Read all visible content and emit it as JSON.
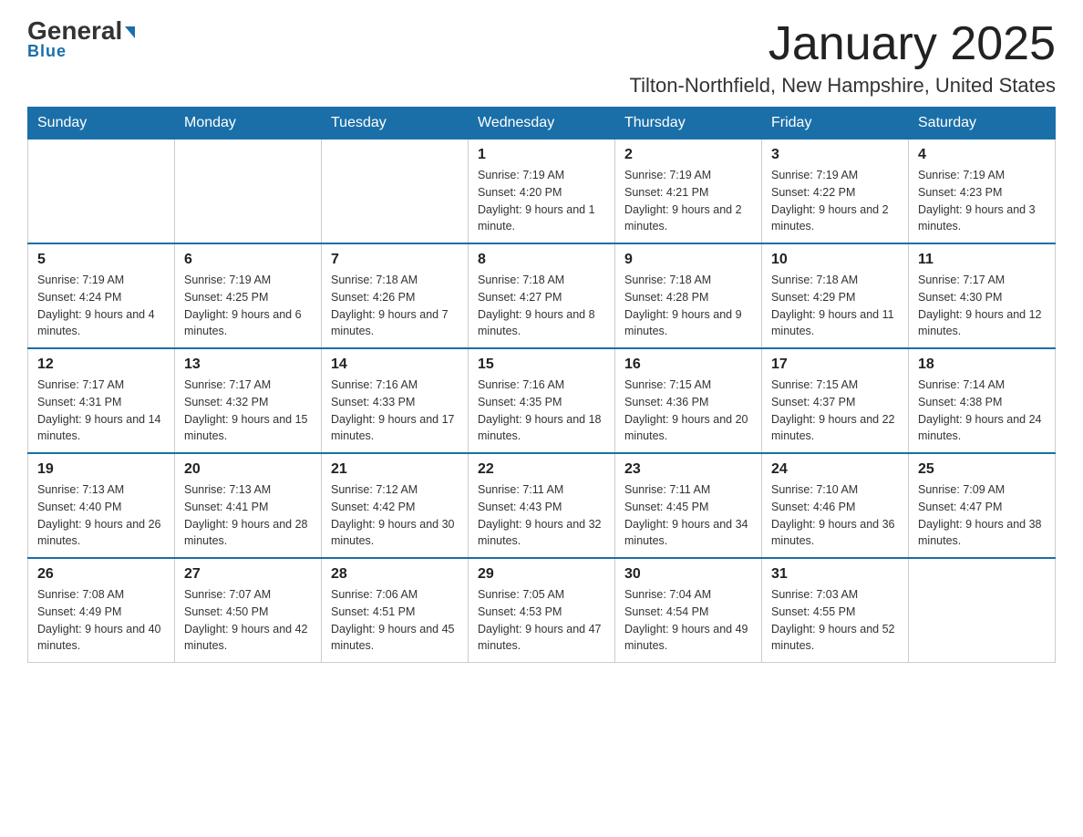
{
  "header": {
    "logo_general": "General",
    "logo_blue": "Blue",
    "month_title": "January 2025",
    "location": "Tilton-Northfield, New Hampshire, United States"
  },
  "weekdays": [
    "Sunday",
    "Monday",
    "Tuesday",
    "Wednesday",
    "Thursday",
    "Friday",
    "Saturday"
  ],
  "weeks": [
    [
      {
        "day": "",
        "info": ""
      },
      {
        "day": "",
        "info": ""
      },
      {
        "day": "",
        "info": ""
      },
      {
        "day": "1",
        "info": "Sunrise: 7:19 AM\nSunset: 4:20 PM\nDaylight: 9 hours and 1 minute."
      },
      {
        "day": "2",
        "info": "Sunrise: 7:19 AM\nSunset: 4:21 PM\nDaylight: 9 hours and 2 minutes."
      },
      {
        "day": "3",
        "info": "Sunrise: 7:19 AM\nSunset: 4:22 PM\nDaylight: 9 hours and 2 minutes."
      },
      {
        "day": "4",
        "info": "Sunrise: 7:19 AM\nSunset: 4:23 PM\nDaylight: 9 hours and 3 minutes."
      }
    ],
    [
      {
        "day": "5",
        "info": "Sunrise: 7:19 AM\nSunset: 4:24 PM\nDaylight: 9 hours and 4 minutes."
      },
      {
        "day": "6",
        "info": "Sunrise: 7:19 AM\nSunset: 4:25 PM\nDaylight: 9 hours and 6 minutes."
      },
      {
        "day": "7",
        "info": "Sunrise: 7:18 AM\nSunset: 4:26 PM\nDaylight: 9 hours and 7 minutes."
      },
      {
        "day": "8",
        "info": "Sunrise: 7:18 AM\nSunset: 4:27 PM\nDaylight: 9 hours and 8 minutes."
      },
      {
        "day": "9",
        "info": "Sunrise: 7:18 AM\nSunset: 4:28 PM\nDaylight: 9 hours and 9 minutes."
      },
      {
        "day": "10",
        "info": "Sunrise: 7:18 AM\nSunset: 4:29 PM\nDaylight: 9 hours and 11 minutes."
      },
      {
        "day": "11",
        "info": "Sunrise: 7:17 AM\nSunset: 4:30 PM\nDaylight: 9 hours and 12 minutes."
      }
    ],
    [
      {
        "day": "12",
        "info": "Sunrise: 7:17 AM\nSunset: 4:31 PM\nDaylight: 9 hours and 14 minutes."
      },
      {
        "day": "13",
        "info": "Sunrise: 7:17 AM\nSunset: 4:32 PM\nDaylight: 9 hours and 15 minutes."
      },
      {
        "day": "14",
        "info": "Sunrise: 7:16 AM\nSunset: 4:33 PM\nDaylight: 9 hours and 17 minutes."
      },
      {
        "day": "15",
        "info": "Sunrise: 7:16 AM\nSunset: 4:35 PM\nDaylight: 9 hours and 18 minutes."
      },
      {
        "day": "16",
        "info": "Sunrise: 7:15 AM\nSunset: 4:36 PM\nDaylight: 9 hours and 20 minutes."
      },
      {
        "day": "17",
        "info": "Sunrise: 7:15 AM\nSunset: 4:37 PM\nDaylight: 9 hours and 22 minutes."
      },
      {
        "day": "18",
        "info": "Sunrise: 7:14 AM\nSunset: 4:38 PM\nDaylight: 9 hours and 24 minutes."
      }
    ],
    [
      {
        "day": "19",
        "info": "Sunrise: 7:13 AM\nSunset: 4:40 PM\nDaylight: 9 hours and 26 minutes."
      },
      {
        "day": "20",
        "info": "Sunrise: 7:13 AM\nSunset: 4:41 PM\nDaylight: 9 hours and 28 minutes."
      },
      {
        "day": "21",
        "info": "Sunrise: 7:12 AM\nSunset: 4:42 PM\nDaylight: 9 hours and 30 minutes."
      },
      {
        "day": "22",
        "info": "Sunrise: 7:11 AM\nSunset: 4:43 PM\nDaylight: 9 hours and 32 minutes."
      },
      {
        "day": "23",
        "info": "Sunrise: 7:11 AM\nSunset: 4:45 PM\nDaylight: 9 hours and 34 minutes."
      },
      {
        "day": "24",
        "info": "Sunrise: 7:10 AM\nSunset: 4:46 PM\nDaylight: 9 hours and 36 minutes."
      },
      {
        "day": "25",
        "info": "Sunrise: 7:09 AM\nSunset: 4:47 PM\nDaylight: 9 hours and 38 minutes."
      }
    ],
    [
      {
        "day": "26",
        "info": "Sunrise: 7:08 AM\nSunset: 4:49 PM\nDaylight: 9 hours and 40 minutes."
      },
      {
        "day": "27",
        "info": "Sunrise: 7:07 AM\nSunset: 4:50 PM\nDaylight: 9 hours and 42 minutes."
      },
      {
        "day": "28",
        "info": "Sunrise: 7:06 AM\nSunset: 4:51 PM\nDaylight: 9 hours and 45 minutes."
      },
      {
        "day": "29",
        "info": "Sunrise: 7:05 AM\nSunset: 4:53 PM\nDaylight: 9 hours and 47 minutes."
      },
      {
        "day": "30",
        "info": "Sunrise: 7:04 AM\nSunset: 4:54 PM\nDaylight: 9 hours and 49 minutes."
      },
      {
        "day": "31",
        "info": "Sunrise: 7:03 AM\nSunset: 4:55 PM\nDaylight: 9 hours and 52 minutes."
      },
      {
        "day": "",
        "info": ""
      }
    ]
  ]
}
